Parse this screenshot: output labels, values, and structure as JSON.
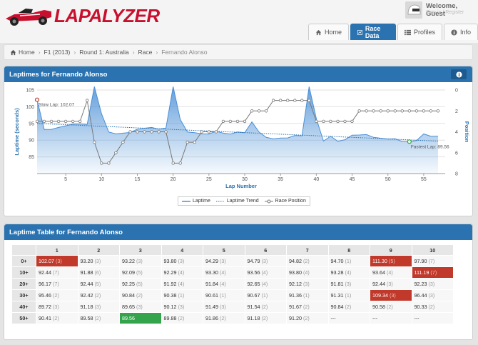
{
  "app": {
    "logo_text": "LAPALYZER"
  },
  "user": {
    "welcome": "Welcome, Guest",
    "sub": "Sign in / Register"
  },
  "tabs": [
    {
      "label": "Home",
      "icon": "home-icon",
      "active": false
    },
    {
      "label": "Race Data",
      "icon": "chart-icon",
      "active": true
    },
    {
      "label": "Profiles",
      "icon": "list-icon",
      "active": false
    },
    {
      "label": "Info",
      "icon": "info-icon",
      "active": false
    }
  ],
  "breadcrumb": [
    "Home",
    "F1 (2013)",
    "Round 1: Australia",
    "Race",
    "Fernando Alonso"
  ],
  "chart_panel": {
    "title": "Laptimes for Fernando Alonso"
  },
  "chart_data": {
    "type": "line",
    "title": "",
    "xlabel": "Lap Number",
    "ylabel": "Laptime (seconds)",
    "y2label": "Position",
    "xlim": [
      1,
      58
    ],
    "ylim": [
      80,
      105
    ],
    "y2lim": [
      8,
      0
    ],
    "x_ticks": [
      5,
      10,
      15,
      20,
      25,
      30,
      35,
      40,
      45,
      50,
      55
    ],
    "y_ticks": [
      85,
      90,
      95,
      100,
      105
    ],
    "y2_ticks": [
      0,
      2,
      4,
      6,
      8
    ],
    "annotations": [
      {
        "label": "Slow Lap: 102.07",
        "lap": 1,
        "value": 102.07,
        "color": "#c0392b"
      },
      {
        "label": "Fastest Lap: 89.56",
        "lap": 53,
        "value": 89.56,
        "color": "#33a34c"
      }
    ],
    "series": [
      {
        "name": "Laptime",
        "color": "#4a8fd6",
        "values": [
          102.07,
          93.2,
          93.22,
          93.8,
          94.29,
          94.79,
          94.82,
          94.7,
          111.3,
          97.9,
          92.44,
          91.88,
          92.09,
          92.29,
          93.3,
          93.56,
          93.8,
          93.28,
          93.64,
          111.19,
          96.17,
          92.44,
          92.25,
          91.92,
          91.84,
          92.65,
          92.12,
          91.81,
          92.44,
          92.23,
          95.46,
          92.42,
          90.84,
          90.38,
          90.61,
          90.67,
          91.36,
          91.31,
          109.34,
          96.44,
          89.72,
          91.18,
          89.65,
          90.12,
          91.49,
          91.54,
          91.67,
          90.84,
          90.58,
          90.33,
          90.41,
          89.58,
          89.56,
          89.88,
          91.86,
          91.18,
          91.2
        ]
      },
      {
        "name": "Laptime Trend",
        "color": "#2a73b0",
        "start": 95.0,
        "end": 89.7
      },
      {
        "name": "Race Position",
        "color": "#777777",
        "axis": "y2",
        "values": [
          3,
          3,
          3,
          3,
          3,
          3,
          3,
          1,
          5,
          7,
          7,
          6,
          5,
          4,
          4,
          4,
          4,
          4,
          4,
          7,
          7,
          5,
          5,
          4,
          4,
          4,
          3,
          3,
          3,
          3,
          2,
          2,
          2,
          1,
          1,
          1,
          1,
          1,
          1,
          3,
          3,
          3,
          3,
          3,
          3,
          2,
          2,
          2,
          2,
          2,
          2,
          2,
          2,
          2,
          2,
          2,
          2
        ]
      }
    ],
    "legend": [
      "Laptime",
      "Laptime Trend",
      "Race Position"
    ],
    "legend_position": "bottom-center"
  },
  "table_panel": {
    "title": "Laptime Table for Fernando Alonso"
  },
  "table": {
    "columns": [
      "1",
      "2",
      "3",
      "4",
      "5",
      "6",
      "7",
      "8",
      "9",
      "10"
    ],
    "rows": [
      {
        "label": "0+",
        "cells": [
          {
            "t": "102.07",
            "p": "(3)",
            "hl": "red"
          },
          {
            "t": "93.20",
            "p": "(3)"
          },
          {
            "t": "93.22",
            "p": "(3)"
          },
          {
            "t": "93.80",
            "p": "(3)"
          },
          {
            "t": "94.29",
            "p": "(3)"
          },
          {
            "t": "94.79",
            "p": "(3)"
          },
          {
            "t": "94.82",
            "p": "(2)"
          },
          {
            "t": "94.70",
            "p": "(1)"
          },
          {
            "t": "111.30",
            "p": "(5)",
            "hl": "red"
          },
          {
            "t": "97.90",
            "p": "(7)"
          }
        ]
      },
      {
        "label": "10+",
        "cells": [
          {
            "t": "92.44",
            "p": "(7)"
          },
          {
            "t": "91.88",
            "p": "(6)"
          },
          {
            "t": "92.09",
            "p": "(5)"
          },
          {
            "t": "92.29",
            "p": "(4)"
          },
          {
            "t": "93.30",
            "p": "(4)"
          },
          {
            "t": "93.56",
            "p": "(4)"
          },
          {
            "t": "93.80",
            "p": "(4)"
          },
          {
            "t": "93.28",
            "p": "(4)"
          },
          {
            "t": "93.64",
            "p": "(4)"
          },
          {
            "t": "111.19",
            "p": "(7)",
            "hl": "red"
          }
        ]
      },
      {
        "label": "20+",
        "cells": [
          {
            "t": "96.17",
            "p": "(7)"
          },
          {
            "t": "92.44",
            "p": "(5)"
          },
          {
            "t": "92.25",
            "p": "(5)"
          },
          {
            "t": "91.92",
            "p": "(4)"
          },
          {
            "t": "91.84",
            "p": "(4)"
          },
          {
            "t": "92.65",
            "p": "(4)"
          },
          {
            "t": "92.12",
            "p": "(3)"
          },
          {
            "t": "91.81",
            "p": "(3)"
          },
          {
            "t": "92.44",
            "p": "(3)"
          },
          {
            "t": "92.23",
            "p": "(3)"
          }
        ]
      },
      {
        "label": "30+",
        "cells": [
          {
            "t": "95.46",
            "p": "(2)"
          },
          {
            "t": "92.42",
            "p": "(2)"
          },
          {
            "t": "90.84",
            "p": "(2)"
          },
          {
            "t": "90.38",
            "p": "(1)"
          },
          {
            "t": "90.61",
            "p": "(1)"
          },
          {
            "t": "90.67",
            "p": "(1)"
          },
          {
            "t": "91.36",
            "p": "(1)"
          },
          {
            "t": "91.31",
            "p": "(1)"
          },
          {
            "t": "109.34",
            "p": "(3)",
            "hl": "red"
          },
          {
            "t": "96.44",
            "p": "(3)"
          }
        ]
      },
      {
        "label": "40+",
        "cells": [
          {
            "t": "89.72",
            "p": "(3)"
          },
          {
            "t": "91.18",
            "p": "(3)"
          },
          {
            "t": "89.65",
            "p": "(3)"
          },
          {
            "t": "90.12",
            "p": "(3)"
          },
          {
            "t": "91.49",
            "p": "(3)"
          },
          {
            "t": "91.54",
            "p": "(2)"
          },
          {
            "t": "91.67",
            "p": "(2)"
          },
          {
            "t": "90.84",
            "p": "(2)"
          },
          {
            "t": "90.58",
            "p": "(2)"
          },
          {
            "t": "90.33",
            "p": "(2)"
          }
        ]
      },
      {
        "label": "50+",
        "cells": [
          {
            "t": "90.41",
            "p": "(2)"
          },
          {
            "t": "89.58",
            "p": "(2)"
          },
          {
            "t": "89.56",
            "p": "",
            "hl": "green"
          },
          {
            "t": "89.88",
            "p": "(2)"
          },
          {
            "t": "91.86",
            "p": "(2)"
          },
          {
            "t": "91.18",
            "p": "(2)"
          },
          {
            "t": "91.20",
            "p": "(2)"
          },
          {
            "t": "---",
            "p": ""
          },
          {
            "t": "---",
            "p": ""
          },
          {
            "t": "---",
            "p": ""
          }
        ]
      }
    ]
  }
}
